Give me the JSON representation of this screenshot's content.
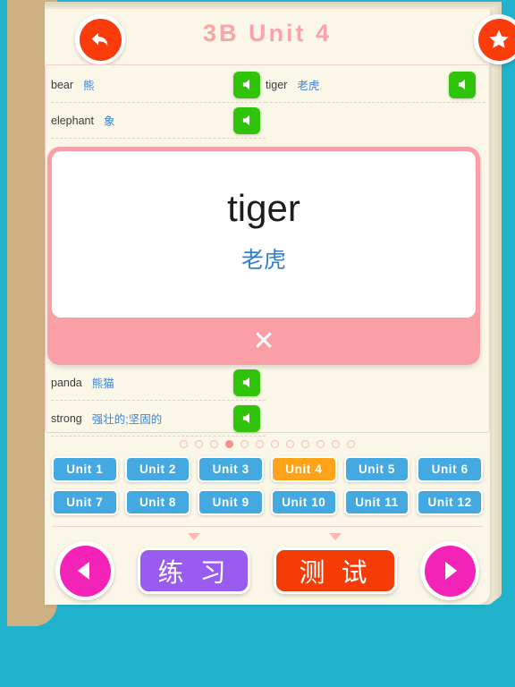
{
  "header": {
    "title": "3B  Unit 4",
    "back_icon": "back-arrow-icon",
    "star_icon": "star-icon",
    "accent_color": "#fba3a6",
    "button_color": "#fa3c0a"
  },
  "word_list": {
    "speaker_icon": "speaker-icon",
    "speaker_color": "#2fc40a",
    "rows": [
      {
        "en": "bear",
        "zh": "熊",
        "column": "left",
        "index": 0
      },
      {
        "en": "tiger",
        "zh": "老虎",
        "column": "right",
        "index": 0
      },
      {
        "en": "elephant",
        "zh": "象",
        "column": "left",
        "index": 1
      },
      {
        "en": "panda",
        "zh": "熊猫",
        "column": "left",
        "index": 2
      },
      {
        "en": "strong",
        "zh": "强壮的;坚固的",
        "column": "left",
        "index": 3
      }
    ]
  },
  "flashcard": {
    "word_en": "tiger",
    "word_zh": "老虎",
    "close_label": "✕",
    "close_icon": "close-x-icon",
    "frame_color": "#fb9fa6",
    "face_color": "#ffffff",
    "word_zh_color": "#2e7fd4"
  },
  "pagination": {
    "total": 12,
    "active_index": 4,
    "dot_color": "#fcb8b2",
    "active_color": "#fb9089"
  },
  "units": {
    "active_label": "Unit 4",
    "default_color": "#43a9e0",
    "active_color": "#ffa418",
    "items": [
      {
        "label": "Unit 1"
      },
      {
        "label": "Unit 2"
      },
      {
        "label": "Unit 3"
      },
      {
        "label": "Unit 4"
      },
      {
        "label": "Unit 5"
      },
      {
        "label": "Unit 6"
      },
      {
        "label": "Unit 7"
      },
      {
        "label": "Unit 8"
      },
      {
        "label": "Unit 9"
      },
      {
        "label": "Unit 10"
      },
      {
        "label": "Unit 11"
      },
      {
        "label": "Unit 12"
      }
    ]
  },
  "bottom_bar": {
    "prev_icon": "triangle-left-icon",
    "next_icon": "triangle-right-icon",
    "nav_color": "#f423b8",
    "practice_label": "练 习",
    "practice_color": "#9a5bf0",
    "test_label": "测 试",
    "test_color": "#f53c07"
  },
  "theme": {
    "background": "#22b3cc",
    "page": "#faf7e8",
    "spine": "#cdb183"
  }
}
